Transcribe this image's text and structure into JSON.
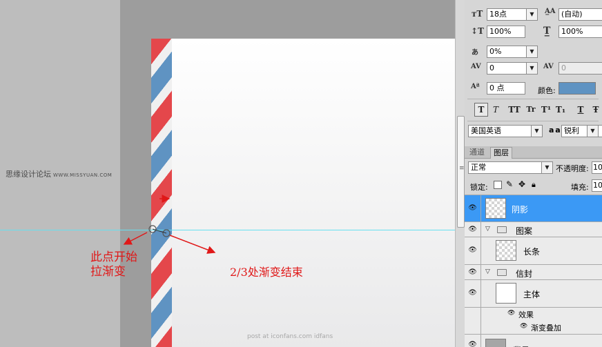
{
  "canvas": {
    "watermark_cn": "思缘设计论坛",
    "watermark_url": "WWW.MISSYUAN.COM",
    "footer_watermark": "post at iconfans.com  idfans",
    "annotation_start_line1": "此点开始",
    "annotation_start_line2": "拉渐变",
    "annotation_end": "2/3处渐变结束"
  },
  "colors": {
    "stripe_red": "#e4474b",
    "stripe_blue": "#5f93c2",
    "guide_cyan": "#66e0f0",
    "annotation_red": "#e01818",
    "selection_blue": "#3b99f5"
  },
  "character": {
    "font_size": "18点",
    "leading": "(自动)",
    "vertical_scale": "100%",
    "horizontal_scale": "100%",
    "tsume": "0%",
    "kerning": "0",
    "tracking": "0",
    "baseline_shift": "0 点",
    "color_label": "颜色:",
    "color_swatch": "#5f93c2",
    "type_buttons": [
      "T",
      "T",
      "TT",
      "Tr",
      "T¹",
      "T₁",
      "T",
      "Ŧ"
    ],
    "language": "美国英语",
    "aa_label": "a a",
    "antialias": "锐利"
  },
  "layers_panel": {
    "tabs": [
      "通道",
      "图层"
    ],
    "blend_mode": "正常",
    "opacity_label": "不透明度:",
    "opacity_value": "10",
    "lock_label": "锁定:",
    "fill_label": "填充:",
    "fill_value": "10",
    "layers": {
      "shadow": "阴影",
      "pattern_group": "图案",
      "long_strip": "长条",
      "envelope_group": "信封",
      "main_body": "主体",
      "effects": "效果",
      "gradient_overlay": "渐变叠加",
      "background": "背景"
    }
  }
}
